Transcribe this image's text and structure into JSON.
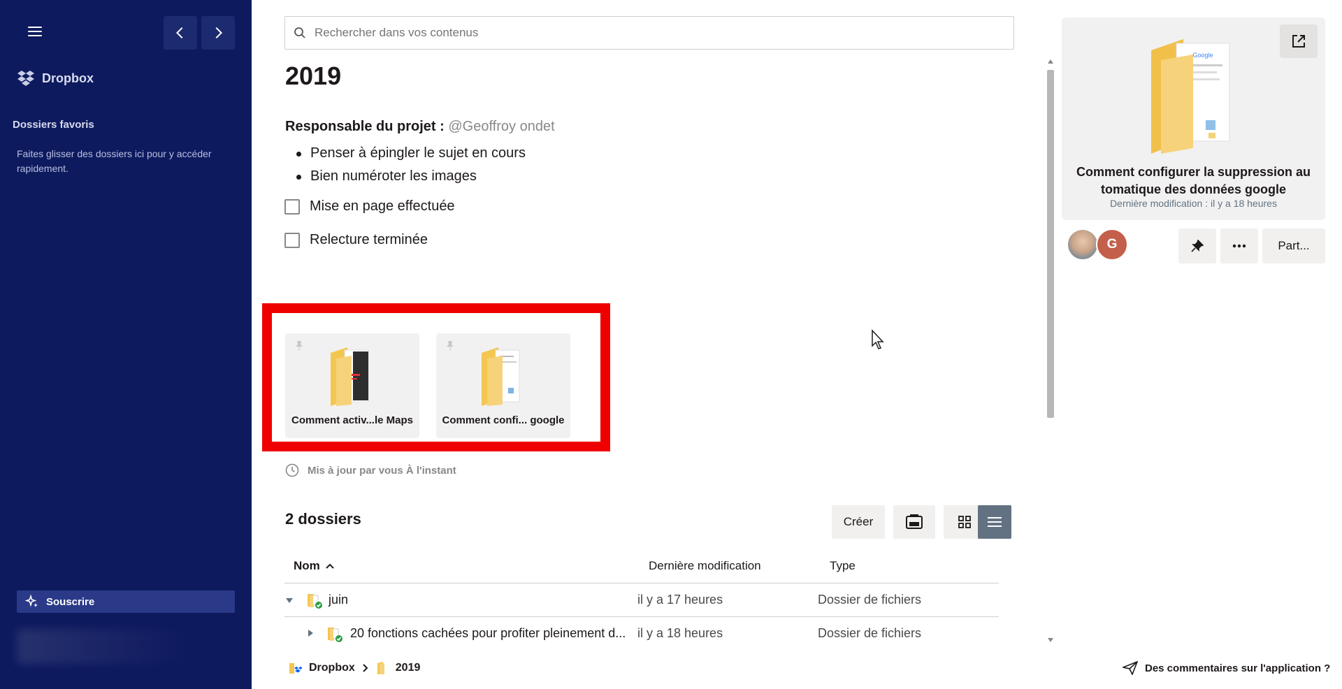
{
  "sidebar": {
    "brand": "Dropbox",
    "favorites_title": "Dossiers favoris",
    "favorites_hint": "Faites glisser des dossiers ici pour y accéder rapidement.",
    "subscribe_label": "Souscrire",
    "colors": {
      "background": "#0d1a5e",
      "subscribe_bg": "#2a3a88"
    }
  },
  "search": {
    "placeholder": "Rechercher dans vos contenus",
    "value": ""
  },
  "doc": {
    "title": "2019",
    "responsible_label": "Responsable du projet :",
    "responsible_mention": "@Geoffroy ondet",
    "bullets": [
      "Penser à épingler le sujet en cours",
      "Bien numéroter les images"
    ],
    "checklist": [
      {
        "label": "Mise en page effectuée",
        "checked": false
      },
      {
        "label": "Relecture terminée",
        "checked": false
      }
    ]
  },
  "pinned": [
    {
      "label": "Comment activ...le Maps",
      "icon": "pin-icon"
    },
    {
      "label": "Comment confi... google",
      "icon": "pin-icon"
    }
  ],
  "updated_text": "Mis à jour par vous À l'instant",
  "folders": {
    "count_label": "2 dossiers",
    "create_label": "Créer",
    "columns": {
      "name": "Nom",
      "modified": "Dernière modification",
      "type": "Type"
    },
    "rows": [
      {
        "name": "juin",
        "modified": "il y a 17 heures",
        "type": "Dossier de fichiers",
        "expanded": true
      },
      {
        "name": "20 fonctions cachées pour profiter pleinement d...",
        "modified": "il y a 18 heures",
        "type": "Dossier de fichiers",
        "expanded": false
      }
    ]
  },
  "breadcrumb": {
    "root": "Dropbox",
    "current": "2019"
  },
  "preview": {
    "title": "Comment configurer la suppression au tomatique des données google",
    "subtitle": "Dernière modification : il y a 18 heures",
    "avatar_letter": "G",
    "share_label": "Part..."
  },
  "feedback_label": "Des commentaires sur l'application ?",
  "colors": {
    "highlight": "#ee0000",
    "folder": "#f6d27a"
  }
}
